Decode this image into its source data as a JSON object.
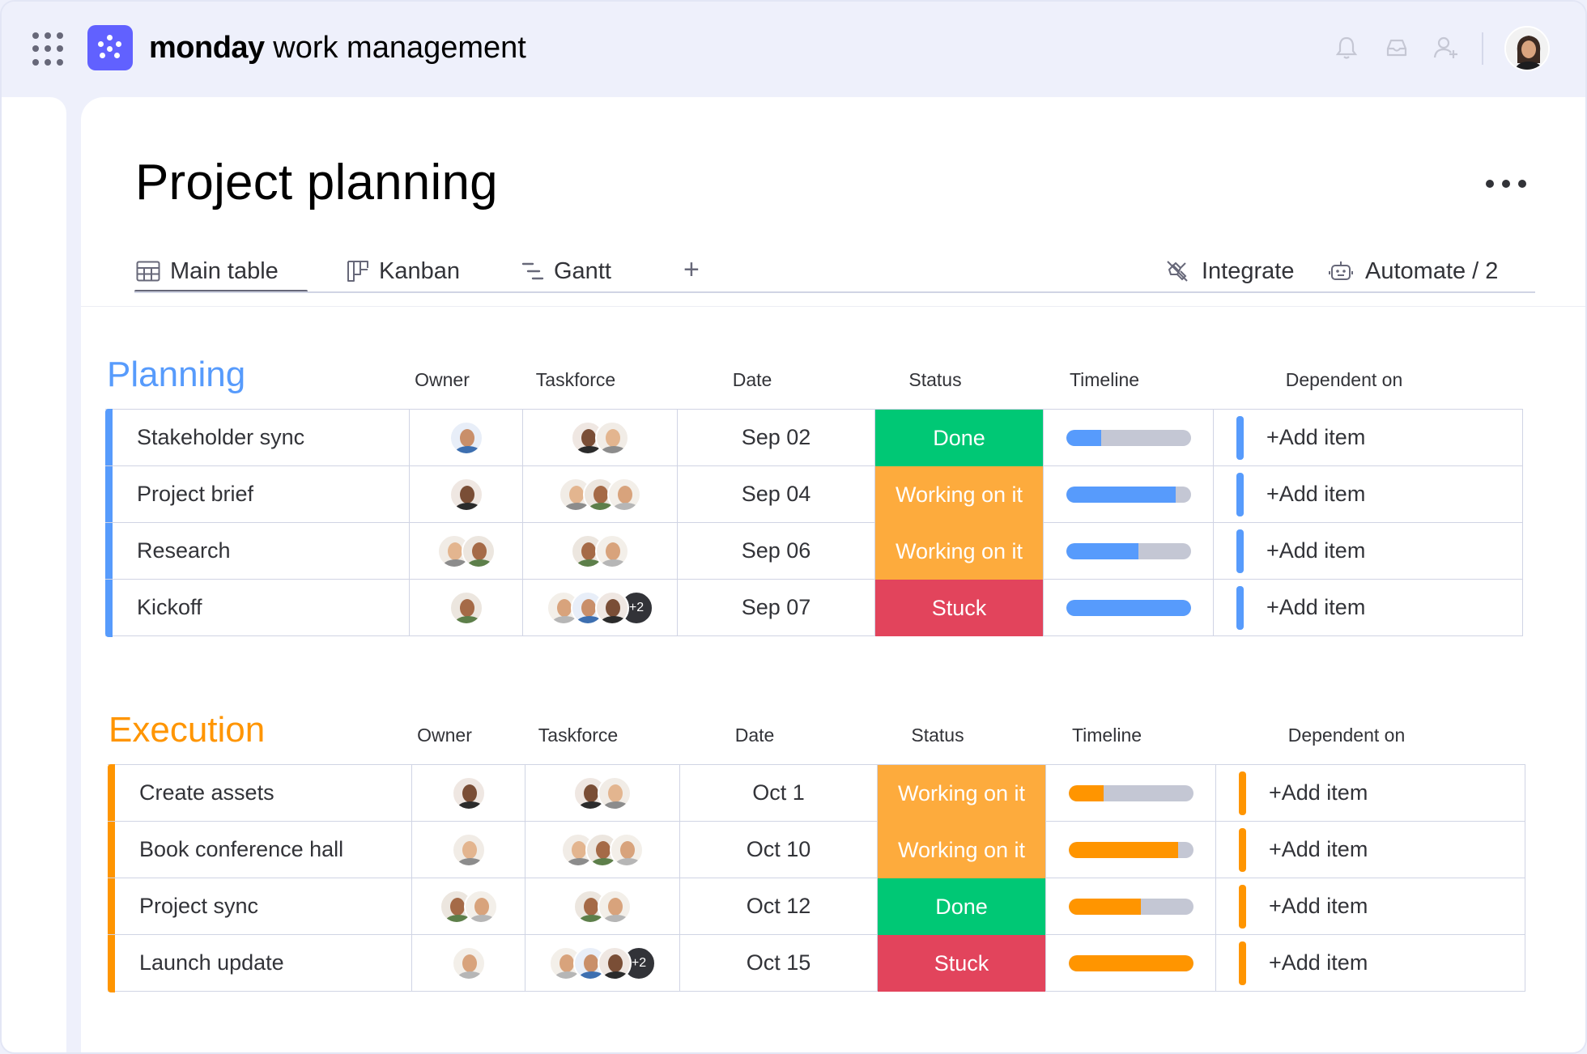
{
  "app": {
    "brand_bold": "monday",
    "brand_light": " work management",
    "colors": {
      "accent": "#6161ff",
      "done": "#00c875",
      "working": "#fdab3d",
      "stuck": "#e2445c",
      "planning": "#579bfc",
      "execution": "#ff9500"
    }
  },
  "header": {
    "icons": [
      "apps-grid-icon",
      "bell-icon",
      "inbox-icon",
      "invite-user-icon",
      "user-avatar"
    ]
  },
  "board": {
    "title": "Project planning",
    "tabs": [
      {
        "label": "Main table",
        "icon": "table-icon"
      },
      {
        "label": "Kanban",
        "icon": "kanban-icon"
      },
      {
        "label": "Gantt",
        "icon": "gantt-icon"
      }
    ],
    "add_tab": "+",
    "actions": [
      {
        "label": "Integrate",
        "icon": "integrate-icon"
      },
      {
        "label": "Automate / 2",
        "icon": "robot-icon"
      }
    ]
  },
  "columns": [
    "Owner",
    "Taskforce",
    "Date",
    "Status",
    "Timeline",
    "Dependent on"
  ],
  "groups": [
    {
      "title": "Planning",
      "color": "#579bfc",
      "rows": [
        {
          "name": "Stakeholder sync",
          "date": "Sep 02",
          "status": "Done",
          "status_color": "#00c875",
          "progress": 0.28,
          "dependent": "+Add item",
          "owner_count": 1,
          "taskforce_count": 2,
          "taskforce_more": ""
        },
        {
          "name": "Project brief",
          "date": "Sep 04",
          "status": "Working on it",
          "status_color": "#fdab3d",
          "progress": 0.88,
          "dependent": "+Add item",
          "owner_count": 1,
          "taskforce_count": 3,
          "taskforce_more": ""
        },
        {
          "name": "Research",
          "date": "Sep 06",
          "status": "Working on it",
          "status_color": "#fdab3d",
          "progress": 0.58,
          "dependent": "+Add item",
          "owner_count": 2,
          "taskforce_count": 2,
          "taskforce_more": ""
        },
        {
          "name": "Kickoff",
          "date": "Sep 07",
          "status": "Stuck",
          "status_color": "#e2445c",
          "progress": 1.0,
          "dependent": "+Add item",
          "owner_count": 1,
          "taskforce_count": 3,
          "taskforce_more": "+2"
        }
      ]
    },
    {
      "title": "Execution",
      "color": "#ff9500",
      "rows": [
        {
          "name": "Create assets",
          "date": "Oct 1",
          "status": "Working on it",
          "status_color": "#fdab3d",
          "progress": 0.28,
          "dependent": "+Add item",
          "owner_count": 1,
          "taskforce_count": 2,
          "taskforce_more": ""
        },
        {
          "name": "Book conference hall",
          "date": "Oct 10",
          "status": "Working on it",
          "status_color": "#fdab3d",
          "progress": 0.88,
          "dependent": "+Add item",
          "owner_count": 1,
          "taskforce_count": 3,
          "taskforce_more": ""
        },
        {
          "name": "Project sync",
          "date": "Oct 12",
          "status": "Done",
          "status_color": "#00c875",
          "progress": 0.58,
          "dependent": "+Add item",
          "owner_count": 2,
          "taskforce_count": 2,
          "taskforce_more": ""
        },
        {
          "name": "Launch update",
          "date": "Oct 15",
          "status": "Stuck",
          "status_color": "#e2445c",
          "progress": 1.0,
          "dependent": "+Add item",
          "owner_count": 1,
          "taskforce_count": 3,
          "taskforce_more": "+2"
        }
      ]
    }
  ]
}
